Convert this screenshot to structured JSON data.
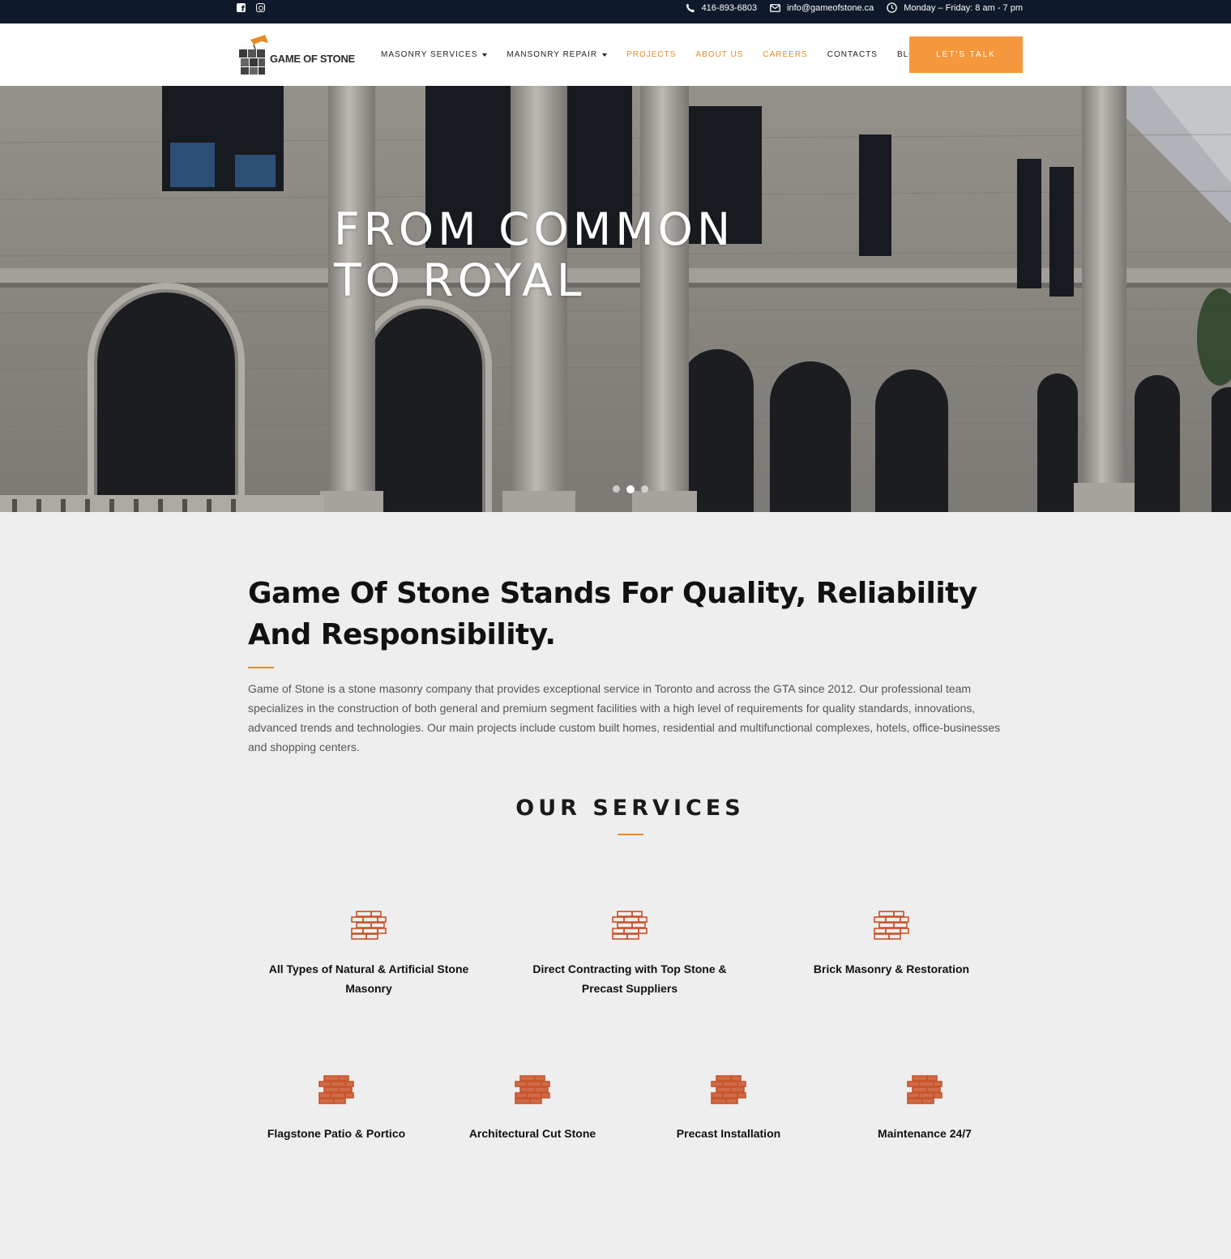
{
  "topbar": {
    "social": [
      "facebook-icon",
      "instagram-icon"
    ],
    "phone": "416-893-6803",
    "email": "info@gameofstone.ca",
    "hours": "Monday – Friday: 8 am - 7 pm"
  },
  "header": {
    "logo_text": "GAME OF STONE",
    "nav": [
      {
        "label": "MASONRY SERVICES",
        "dropdown": true,
        "accent": false
      },
      {
        "label": "MANSONRY REPAIR",
        "dropdown": true,
        "accent": false
      },
      {
        "label": "PROJECTS",
        "dropdown": false,
        "accent": true
      },
      {
        "label": "ABOUT US",
        "dropdown": false,
        "accent": true
      },
      {
        "label": "CAREERS",
        "dropdown": false,
        "accent": true
      },
      {
        "label": "CONTACTS",
        "dropdown": false,
        "accent": false
      },
      {
        "label": "BLOG",
        "dropdown": false,
        "accent": false
      }
    ],
    "cta_label": "LET'S TALK"
  },
  "hero": {
    "title_line1": "FROM COMMON",
    "title_line2": "TO ROYAL",
    "slides": 3,
    "active_slide": 2
  },
  "about": {
    "heading": "Game Of Stone Stands For Quality, Reliability And Responsibility.",
    "text": "Game of Stone is a stone masonry company that provides exceptional service in Toronto and across the GTA since 2012. Our professional team specializes in the construction of both general and premium segment facilities with a high level of requirements for quality standards, innovations, advanced trends and technologies. Our main projects include custom built homes, residential and multifunctional complexes, hotels, office-businesses and shopping centers."
  },
  "services": {
    "title": "OUR SERVICES",
    "items": [
      {
        "label": "All Types of Natural & Artificial Stone Masonry",
        "icon": "brick-icon"
      },
      {
        "label": "Direct Contracting with Top Stone & Precast Suppliers",
        "icon": "brick-icon"
      },
      {
        "label": "Brick Masonry & Restoration",
        "icon": "brick-icon"
      },
      {
        "label": "Flagstone Patio & Portico",
        "icon": "brick-icon"
      },
      {
        "label": "Architectural Cut Stone",
        "icon": "brick-icon"
      },
      {
        "label": "Precast Installation",
        "icon": "brick-icon"
      },
      {
        "label": "Maintenance 24/7",
        "icon": "brick-icon"
      }
    ]
  },
  "colors": {
    "topbar": "#0e1a2b",
    "accent": "#e48c2a",
    "cta": "#f5973d",
    "brick": "#c8532a"
  }
}
